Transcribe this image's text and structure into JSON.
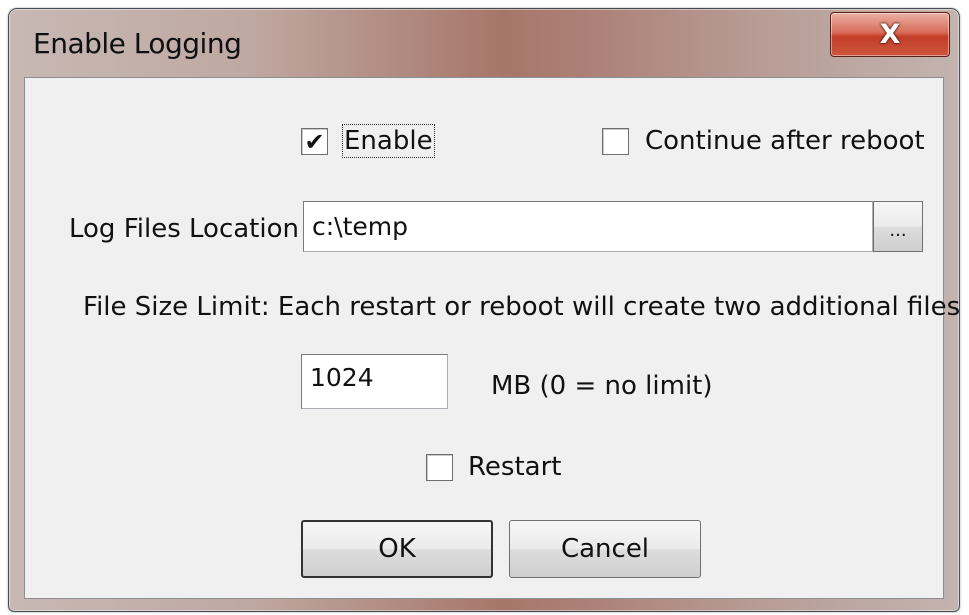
{
  "window": {
    "title": "Enable Logging",
    "close_glyph": "X"
  },
  "enable": {
    "label": "Enable",
    "checked": true,
    "mark": "✔"
  },
  "continue_after_reboot": {
    "label": "Continue after reboot",
    "checked": false
  },
  "log_files_location": {
    "label": "Log Files Location",
    "value": "c:\\temp",
    "browse_label": "..."
  },
  "file_size": {
    "description": "File Size Limit: Each restart or reboot will create two additional files.",
    "value": "1024",
    "unit_label": "MB (0 = no limit)"
  },
  "restart": {
    "label": "Restart",
    "checked": false
  },
  "buttons": {
    "ok": "OK",
    "cancel": "Cancel"
  }
}
